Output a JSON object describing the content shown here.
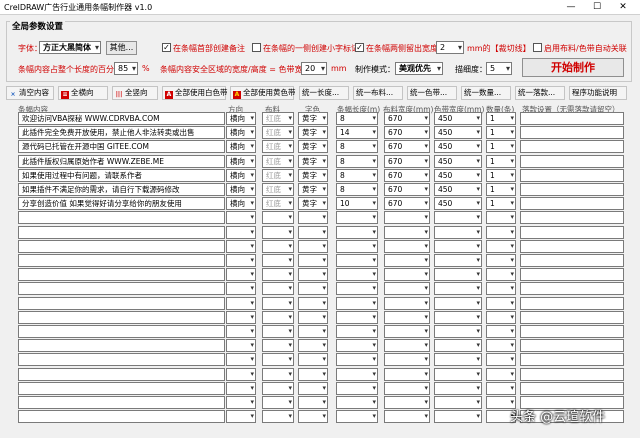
{
  "window": {
    "title": "CrelDRAW广告行业通用条幅制作器 v1.0",
    "min": "—",
    "max": "☐",
    "close": "✕"
  },
  "params": {
    "group_title": "全局参数设置",
    "font_label": "字体：",
    "font_value": "方正大黑简体",
    "other_btn": "其他...",
    "cb1": "在条幅首部创建备注",
    "cb2": "在条幅的一侧创建小字标记",
    "cb3": "在条幅两侧留出宽度为",
    "side_value": "2",
    "side_unit": "mm的【裁切线】",
    "cb4": "启用布料/色带自动关联",
    "pct_label": "条幅内容占整个长度的百分比：",
    "pct_value": "85",
    "pct_unit": "%",
    "formula_label": "条幅内容安全区域的宽度/高度 = 色带宽度 -",
    "formula_value": "20",
    "formula_unit": "mm",
    "mode_label": "制作模式：",
    "mode_value": "美观优先",
    "thick_label": "描细度：",
    "thick_value": "5",
    "start_btn": "开始制作"
  },
  "toolbar": [
    {
      "label": "清空内容",
      "icon": "×"
    },
    {
      "label": "全横向",
      "icon": "≡"
    },
    {
      "label": "全竖向",
      "icon": "|||"
    },
    {
      "label": "全部使用白色带",
      "icon": "A"
    },
    {
      "label": "全部使用黄色带",
      "icon": "A"
    },
    {
      "label": "统一长度..."
    },
    {
      "label": "统一布料..."
    },
    {
      "label": "统一色带..."
    },
    {
      "label": "统一数量..."
    },
    {
      "label": "统一落款..."
    },
    {
      "label": "程序功能说明"
    }
  ],
  "headers": [
    "条幅内容",
    "方向",
    "布料",
    "字色",
    "条幅长度(m)",
    "布料宽度(mm)",
    "色带宽度(mm)",
    "数量(条)",
    "落款设置（无需落款请留空）"
  ],
  "rows": [
    {
      "content": "欢迎访问VBA探秘 WWW.CDRVBA.COM",
      "dir": "横向",
      "cloth": "红底",
      "color": "黄字",
      "len": "8",
      "cw": "670",
      "rw": "450",
      "qty": "1",
      "sign": ""
    },
    {
      "content": "此插件完全免费开放使用，禁止他人非法转卖或出售",
      "dir": "横向",
      "cloth": "红底",
      "color": "黄字",
      "len": "14",
      "cw": "670",
      "rw": "450",
      "qty": "1",
      "sign": ""
    },
    {
      "content": "源代码已托管在开源中国 GITEE.COM",
      "dir": "横向",
      "cloth": "红底",
      "color": "黄字",
      "len": "8",
      "cw": "670",
      "rw": "450",
      "qty": "1",
      "sign": ""
    },
    {
      "content": "此插件版权归属原始作者 WWW.ZEBE.ME",
      "dir": "横向",
      "cloth": "红底",
      "color": "黄字",
      "len": "8",
      "cw": "670",
      "rw": "450",
      "qty": "1",
      "sign": ""
    },
    {
      "content": "如果使用过程中有问题，请联系作者",
      "dir": "横向",
      "cloth": "红底",
      "color": "黄字",
      "len": "8",
      "cw": "670",
      "rw": "450",
      "qty": "1",
      "sign": ""
    },
    {
      "content": "如果插件不满足你的需求，请自行下载源码修改",
      "dir": "横向",
      "cloth": "红底",
      "color": "黄字",
      "len": "8",
      "cw": "670",
      "rw": "450",
      "qty": "1",
      "sign": ""
    },
    {
      "content": "分享创造价值 如果觉得好请分享给你的朋友使用",
      "dir": "横向",
      "cloth": "红底",
      "color": "黄字",
      "len": "10",
      "cw": "670",
      "rw": "450",
      "qty": "1",
      "sign": ""
    }
  ],
  "watermark": "头条 @云瑄软件"
}
